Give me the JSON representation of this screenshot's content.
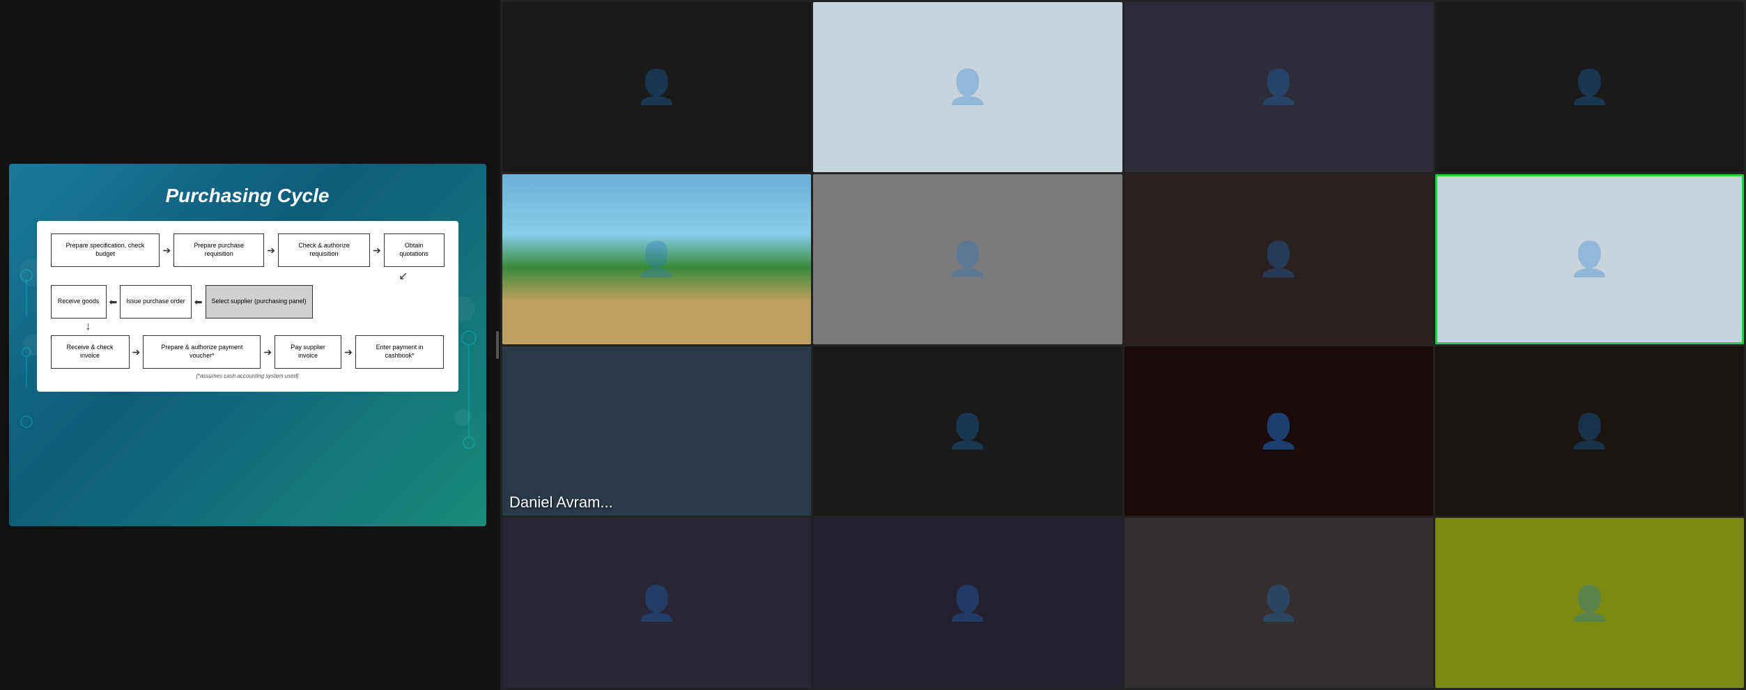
{
  "slide": {
    "title": "Purchasing Cycle",
    "diagram": {
      "row1": [
        "Prepare specification, check budget",
        "Prepare purchase requisition",
        "Check & authorize requisition",
        "Obtain quotations"
      ],
      "row2": [
        "Receive goods",
        "Issue purchase order",
        "Select supplier (purchasing panel)"
      ],
      "row3": [
        "Receive & check invoice",
        "Prepare & authorize payment voucher*",
        "Pay supplier invoice",
        "Enter payment in cashbook*"
      ],
      "footnote": "[*assumes cash accounting system used]"
    }
  },
  "participants": [
    {
      "id": "p1",
      "name": "",
      "cam": "cam-dark",
      "row": 1,
      "col": 1
    },
    {
      "id": "p2",
      "name": "",
      "cam": "cam-bright",
      "row": 1,
      "col": 2
    },
    {
      "id": "p3",
      "name": "",
      "cam": "cam-mid",
      "row": 1,
      "col": 3
    },
    {
      "id": "p4",
      "name": "",
      "cam": "cam-dark",
      "row": 1,
      "col": 4
    },
    {
      "id": "p5",
      "name": "",
      "cam": "cam-beach",
      "row": 2,
      "col": 1
    },
    {
      "id": "p6",
      "name": "",
      "cam": "cam-grey",
      "row": 2,
      "col": 2
    },
    {
      "id": "p7",
      "name": "",
      "cam": "cam-room2",
      "row": 2,
      "col": 3
    },
    {
      "id": "p8",
      "name": "",
      "cam": "cam-bright",
      "row": 2,
      "col": 4,
      "active": true
    },
    {
      "id": "p9",
      "name": "Daniel Avram...",
      "cam": "cam-name",
      "row": 3,
      "col": 1
    },
    {
      "id": "p10",
      "name": "",
      "cam": "cam-dark",
      "row": 3,
      "col": 2
    },
    {
      "id": "p11",
      "name": "",
      "cam": "cam-room2",
      "row": 3,
      "col": 3
    },
    {
      "id": "p12",
      "name": "",
      "cam": "cam-dark",
      "row": 3,
      "col": 4
    },
    {
      "id": "p13",
      "name": "",
      "cam": "cam-mid",
      "row": 4,
      "col": 1
    },
    {
      "id": "p14",
      "name": "",
      "cam": "cam-mid",
      "row": 4,
      "col": 2
    },
    {
      "id": "p15",
      "name": "",
      "cam": "cam-grey",
      "row": 4,
      "col": 3
    },
    {
      "id": "p16",
      "name": "",
      "cam": "cam-yellow",
      "row": 4,
      "col": 4
    }
  ],
  "colors": {
    "active_border": "#2ecc40",
    "background": "#1a1a1a",
    "divider": "#111"
  },
  "labels": {
    "daniel_avram": "Daniel Avram...",
    "receive_goods": "Receive goods",
    "receive_check_invoice": "Receive & check invoice",
    "prepare_spec": "Prepare specification, check budget",
    "prepare_req": "Prepare purchase requisition",
    "check_auth": "Check & authorize requisition",
    "obtain_quot": "Obtain quotations",
    "issue_po": "Issue purchase order",
    "select_supplier": "Select supplier (purchasing panel)",
    "prepare_payment": "Prepare & authorize payment voucher*",
    "pay_invoice": "Pay supplier invoice",
    "enter_payment": "Enter payment in cashbook*",
    "footnote": "[*assumes cash accounting system used]"
  }
}
